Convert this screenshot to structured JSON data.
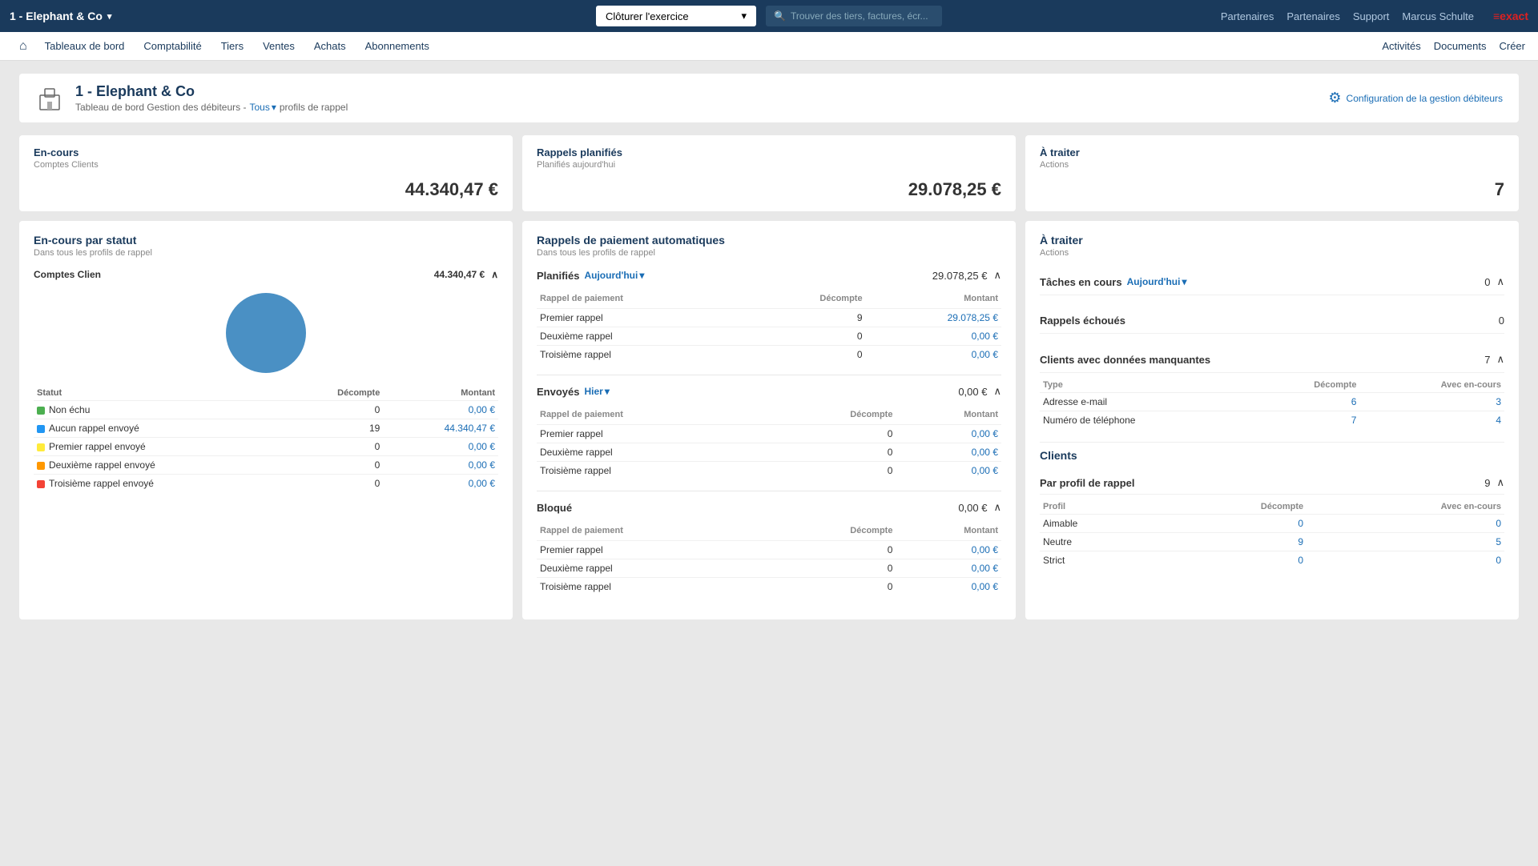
{
  "topbar": {
    "company": "1 - Elephant & Co",
    "dropdown_arrow": "▾",
    "close_btn": "Clôturer l'exercice",
    "search_placeholder": "Trouver des tiers, factures, écr...",
    "partenaires": "Partenaires",
    "support": "Support",
    "user": "Marcus Schulte",
    "activites": "Activités",
    "documents": "Documents",
    "creer": "Créer",
    "exact_logo": "≡exact"
  },
  "navbar": {
    "home_icon": "⌂",
    "items": [
      "Tableaux de bord",
      "Comptabilité",
      "Tiers",
      "Ventes",
      "Achats",
      "Abonnements"
    ]
  },
  "page": {
    "icon": "🏢",
    "title": "1 - Elephant & Co",
    "breadcrumb_base": "Tableau de bord Gestion des débiteurs -",
    "tous": "Tous",
    "breadcrumb_end": "profils de rappel",
    "config_icon": "⚙",
    "config_link": "Configuration de la gestion débiteurs"
  },
  "summary": {
    "en_cours": {
      "title": "En-cours",
      "subtitle": "Comptes Clients",
      "amount": "44.340,47 €"
    },
    "rappels_planifies": {
      "title": "Rappels planifiés",
      "subtitle": "Planifiés aujourd'hui",
      "amount": "29.078,25 €"
    },
    "a_traiter": {
      "title": "À traiter",
      "subtitle": "Actions",
      "amount": "7"
    }
  },
  "en_cours_statut": {
    "panel_title": "En-cours par statut",
    "panel_subtitle": "Dans tous les profils de rappel",
    "comptes_label": "Comptes Clien",
    "comptes_amount": "44.340,47 €",
    "statuts": {
      "header_statut": "Statut",
      "header_decompte": "Décompte",
      "header_montant": "Montant",
      "rows": [
        {
          "color": "#4caf50",
          "label": "Non échu",
          "decompte": "0",
          "montant": "0,00 €"
        },
        {
          "color": "#2196f3",
          "label": "Aucun rappel envoyé",
          "decompte": "19",
          "montant": "44.340,47 €"
        },
        {
          "color": "#ffeb3b",
          "label": "Premier rappel envoyé",
          "decompte": "0",
          "montant": "0,00 €"
        },
        {
          "color": "#ff9800",
          "label": "Deuxième rappel envoyé",
          "decompte": "0",
          "montant": "0,00 €"
        },
        {
          "color": "#f44336",
          "label": "Troisième rappel envoyé",
          "decompte": "0",
          "montant": "0,00 €"
        }
      ]
    }
  },
  "rappels": {
    "panel_title": "Rappels de paiement automatiques",
    "panel_subtitle": "Dans tous les profils de rappel",
    "planifies": {
      "label": "Planifiés",
      "date": "Aujourd'hui",
      "total": "29.078,25 €",
      "header_rappel": "Rappel de paiement",
      "header_decompte": "Décompte",
      "header_montant": "Montant",
      "rows": [
        {
          "label": "Premier rappel",
          "decompte": "9",
          "montant": "29.078,25 €"
        },
        {
          "label": "Deuxième rappel",
          "decompte": "0",
          "montant": "0,00 €"
        },
        {
          "label": "Troisième rappel",
          "decompte": "0",
          "montant": "0,00 €"
        }
      ]
    },
    "envoyes": {
      "label": "Envoyés",
      "date": "Hier",
      "total": "0,00 €",
      "header_rappel": "Rappel de paiement",
      "header_decompte": "Décompte",
      "header_montant": "Montant",
      "rows": [
        {
          "label": "Premier rappel",
          "decompte": "0",
          "montant": "0,00 €"
        },
        {
          "label": "Deuxième rappel",
          "decompte": "0",
          "montant": "0,00 €"
        },
        {
          "label": "Troisième rappel",
          "decompte": "0",
          "montant": "0,00 €"
        }
      ]
    },
    "bloque": {
      "label": "Bloqué",
      "total": "0,00 €",
      "header_rappel": "Rappel de paiement",
      "header_decompte": "Décompte",
      "header_montant": "Montant",
      "rows": [
        {
          "label": "Premier rappel",
          "decompte": "0",
          "montant": "0,00 €"
        },
        {
          "label": "Deuxième rappel",
          "decompte": "0",
          "montant": "0,00 €"
        },
        {
          "label": "Troisième rappel",
          "decompte": "0",
          "montant": "0,00 €"
        }
      ]
    }
  },
  "a_traiter": {
    "panel_title": "À traiter",
    "panel_subtitle": "Actions",
    "taches": {
      "label": "Tâches en cours",
      "date": "Aujourd'hui",
      "count": "0"
    },
    "rappels_echoues": {
      "label": "Rappels échoués",
      "count": "0"
    },
    "clients_manquants": {
      "label": "Clients avec données manquantes",
      "count": "7",
      "header_type": "Type",
      "header_decompte": "Décompte",
      "header_avec": "Avec en-cours",
      "rows": [
        {
          "label": "Adresse e-mail",
          "decompte": "6",
          "avec": "3"
        },
        {
          "label": "Numéro de téléphone",
          "decompte": "7",
          "avec": "4"
        }
      ]
    },
    "clients": {
      "section_title": "Clients",
      "par_profil": {
        "label": "Par profil de rappel",
        "count": "9",
        "header_profil": "Profil",
        "header_decompte": "Décompte",
        "header_avec": "Avec en-cours",
        "rows": [
          {
            "label": "Aimable",
            "decompte": "0",
            "avec": "0"
          },
          {
            "label": "Neutre",
            "decompte": "9",
            "avec": "5"
          },
          {
            "label": "Strict",
            "decompte": "0",
            "avec": "0"
          }
        ]
      }
    }
  }
}
